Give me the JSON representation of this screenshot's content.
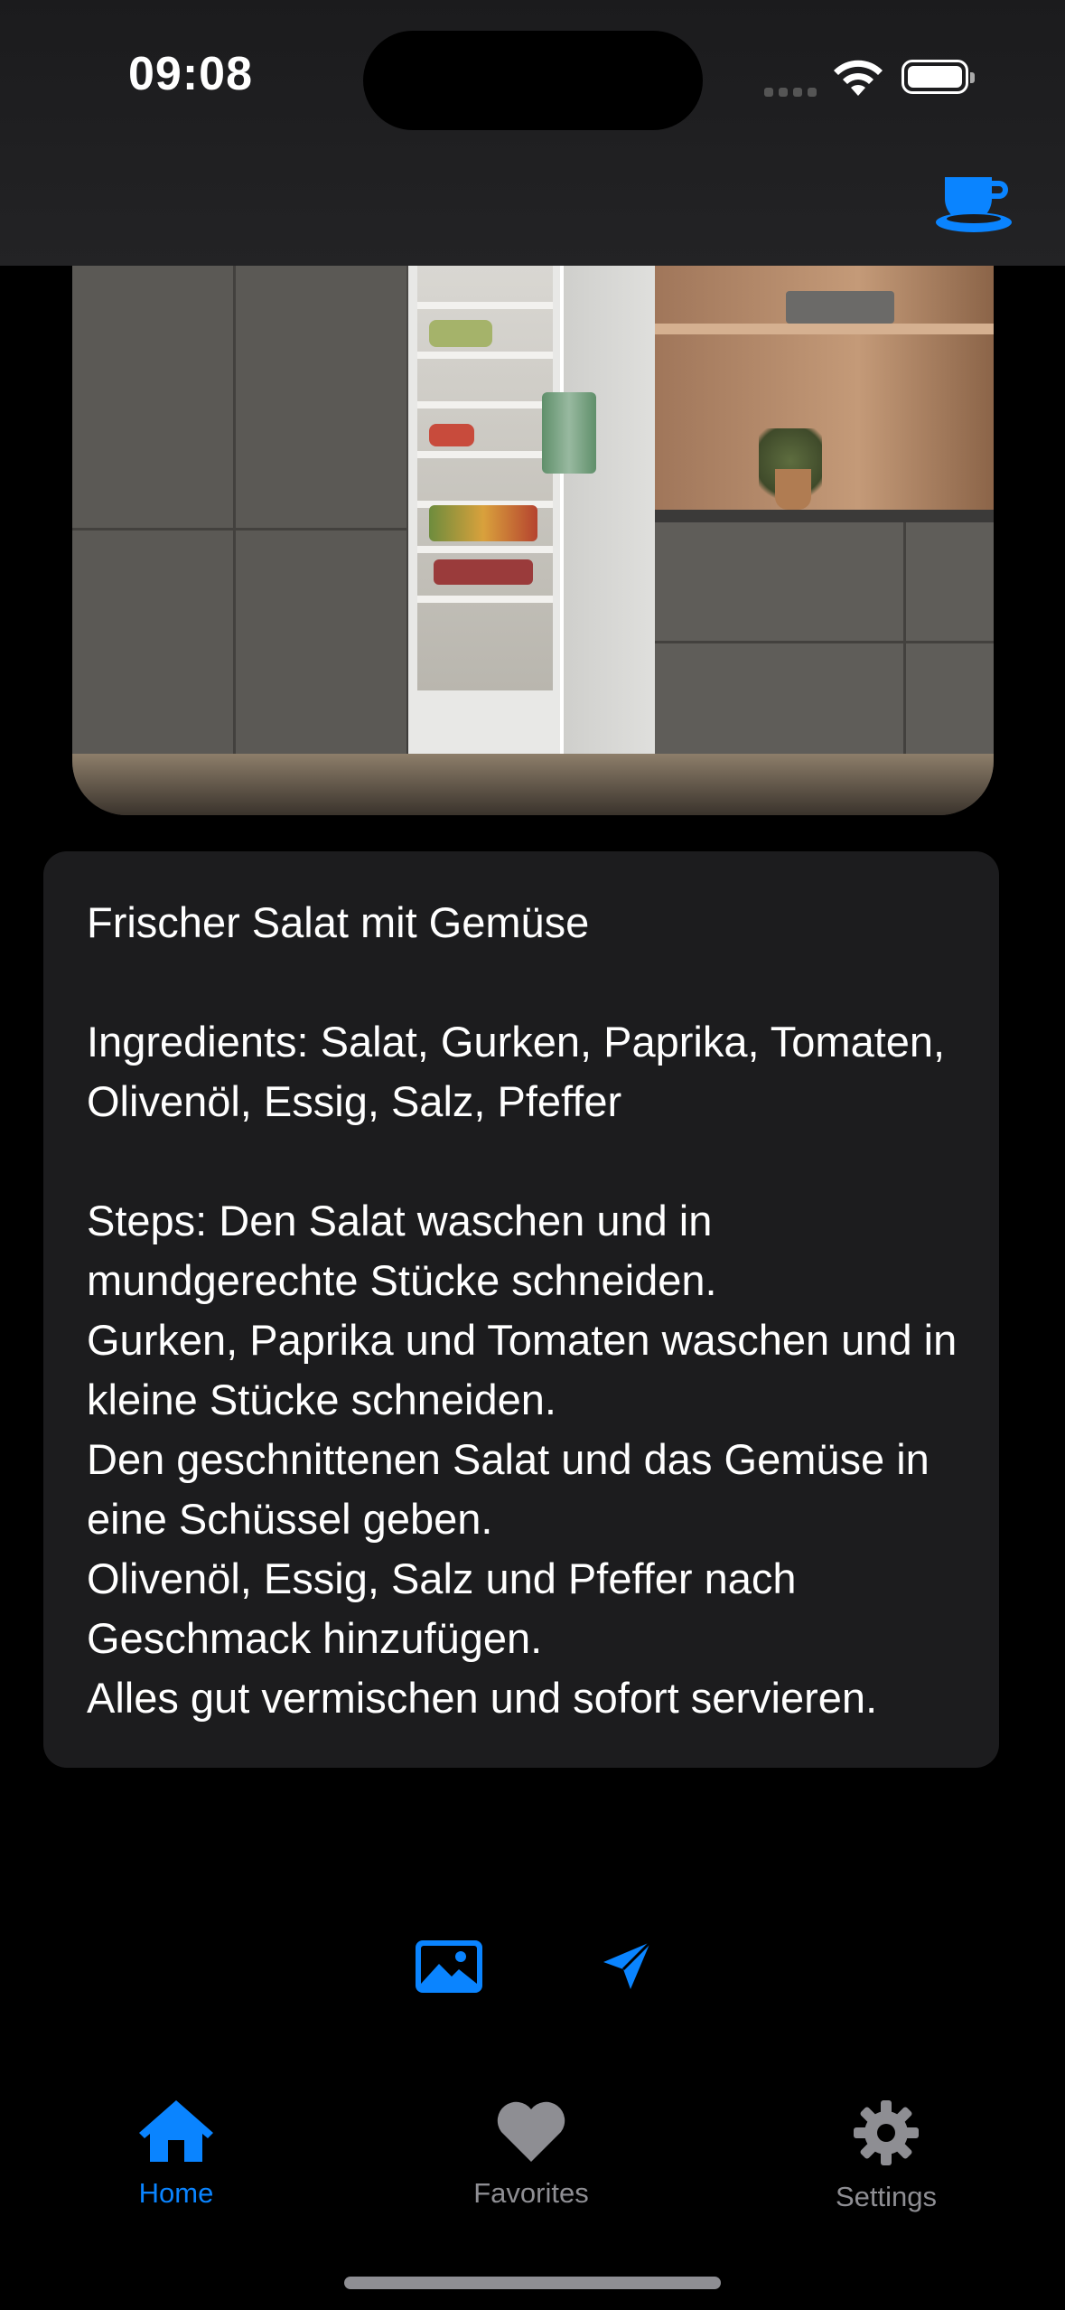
{
  "status_bar": {
    "time": "09:08"
  },
  "header": {
    "right_icon": "coffee-cup-icon"
  },
  "hero_image": {
    "description_icon": "kitchen-fridge-photo"
  },
  "recipe": {
    "text": "Frischer Salat mit Gemüse\n\nIngredients: Salat, Gurken, Paprika, Tomaten, Olivenöl, Essig, Salz, Pfeffer\n\nSteps: Den Salat waschen und in mundgerechte Stücke schneiden.\nGurken, Paprika und Tomaten waschen und in kleine Stücke schneiden.\nDen geschnittenen Salat und das Gemüse in eine Schüssel geben.\nOlivenöl, Essig, Salz und Pfeffer nach Geschmack hinzufügen.\nAlles gut vermischen und sofort servieren."
  },
  "actions": {
    "image_icon": "photo-icon",
    "send_icon": "send-icon"
  },
  "tabs": [
    {
      "label": "Home",
      "icon": "house-icon",
      "active": true
    },
    {
      "label": "Favorites",
      "icon": "heart-icon",
      "active": false
    },
    {
      "label": "Settings",
      "icon": "gear-icon",
      "active": false
    }
  ],
  "colors": {
    "accent": "#0a84ff",
    "inactive": "#8e8e93",
    "card": "#1c1c1e",
    "background": "#000000"
  }
}
